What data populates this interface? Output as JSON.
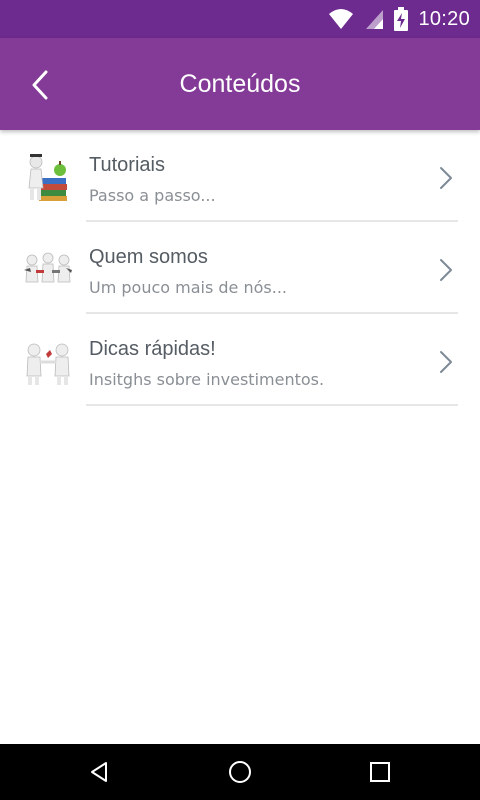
{
  "status": {
    "time": "10:20"
  },
  "header": {
    "title": "Conteúdos",
    "back_icon": "chevron-left-icon"
  },
  "items": [
    {
      "title": "Tutoriais",
      "subtitle": "Passo a passo...",
      "icon": "graduate-books-icon"
    },
    {
      "title": "Quem somos",
      "subtitle": "Um pouco mais de nós...",
      "icon": "team-figures-icon"
    },
    {
      "title": "Dicas rápidas!",
      "subtitle": "Insitghs sobre investimentos.",
      "icon": "handshake-figures-icon"
    }
  ],
  "colors": {
    "statusbar": "#6d2a8f",
    "appbar": "#843b97"
  }
}
